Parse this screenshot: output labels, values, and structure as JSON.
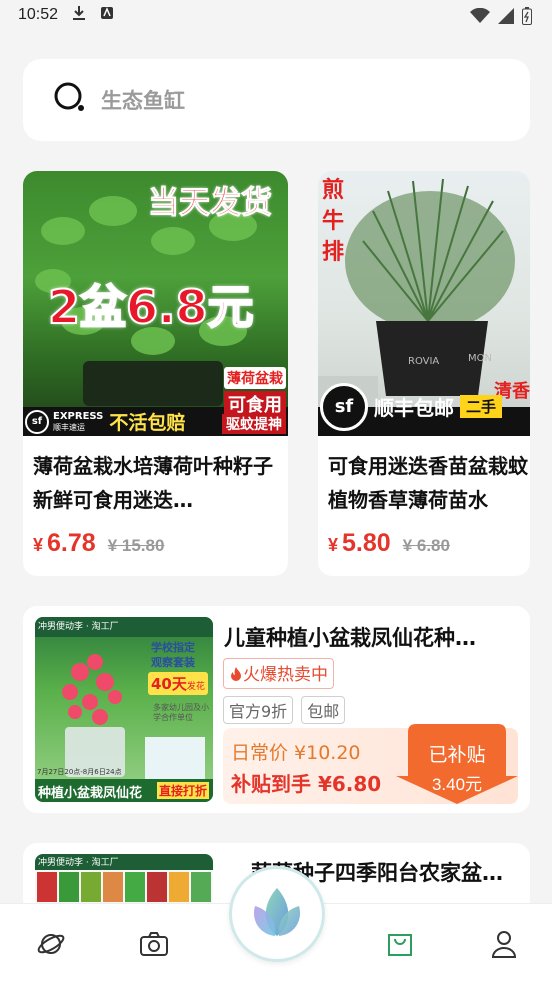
{
  "status_bar": {
    "time": "10:52"
  },
  "search": {
    "placeholder": "生态鱼缸"
  },
  "products": [
    {
      "badge_top": "当天发货",
      "promo": "2盆6.8元",
      "side_tags": [
        "薄荷盆栽",
        "可食用",
        "驱蚊提神"
      ],
      "shipping_brand": "EXPRESS",
      "shipping_brand_cn": "顺丰速运",
      "guarantee": "不活包赔",
      "title": "薄荷盆栽水培薄荷叶种籽子新鲜可食用迷迭…",
      "currency": "¥",
      "price": "6.78",
      "old_price": "¥ 15.80"
    },
    {
      "side_text": [
        "煎",
        "牛",
        "排"
      ],
      "pot_text": "ROVIA",
      "pot_text2": "MON",
      "corner_text": "清香",
      "shipping": "顺丰包邮",
      "corner_tag": "二手",
      "title": "可食用迷迭香苗盆栽蚊植物香草薄荷苗水",
      "currency": "¥",
      "price": "5.80",
      "old_price": "¥ 6.80"
    }
  ],
  "wide_product": {
    "thumb_header": "冲男便动李 · 淘工厂",
    "thumb_badge1": "学校指定",
    "thumb_badge2": "观察套装",
    "thumb_days": "40天",
    "thumb_days_suffix": "发花",
    "thumb_small": "多家幼儿园及小学合作单位",
    "thumb_date": "7月27日20点-8月6日24点",
    "thumb_caption": "种植小盆栽凤仙花",
    "thumb_cta": "直接打折",
    "title": "儿童种植小盆栽凤仙花种…",
    "hot_label": "火爆热卖中",
    "tags": [
      "官方9折",
      "包邮"
    ],
    "daily_price": "日常价 ¥10.20",
    "after_subsidy": "补贴到手 ¥6.80",
    "badge_line1": "已补贴",
    "badge_line2": "3.40元"
  },
  "fourth_product": {
    "thumb_header": "冲男便动李 · 淘工厂",
    "title": "蔬菜种子四季阳台农家盆…"
  },
  "tabbar": {
    "items": [
      "planet-icon",
      "camera-icon",
      "leaf-logo",
      "bag-icon",
      "user-icon"
    ],
    "active": "bag-icon"
  },
  "colors": {
    "price_red": "#e4352b",
    "active_tab": "#2e9e5b",
    "subsidy_orange": "#f26a2e"
  }
}
